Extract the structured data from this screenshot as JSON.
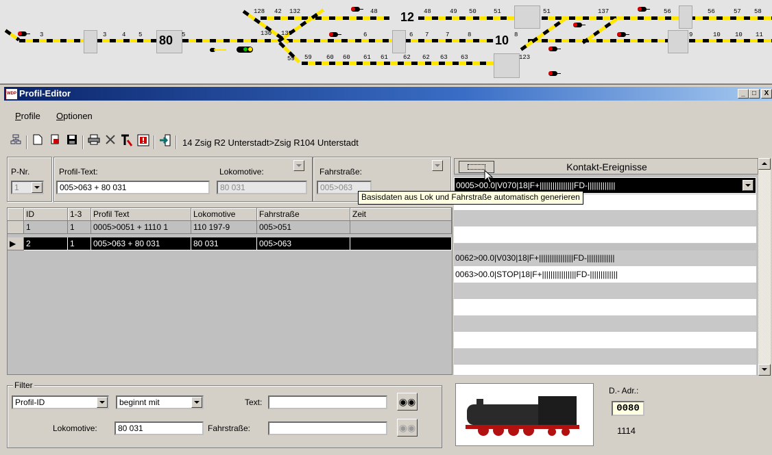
{
  "track_panel": {
    "big_numbers": [
      "80",
      "12",
      "10"
    ],
    "small_numbers": [
      "3",
      "3",
      "4",
      "5",
      "5",
      "128",
      "42",
      "132",
      "48",
      "48",
      "49",
      "50",
      "51",
      "51",
      "137",
      "56",
      "56",
      "57",
      "58",
      "6",
      "6",
      "7",
      "7",
      "8",
      "8",
      "9",
      "10",
      "10",
      "11",
      "59",
      "59",
      "60",
      "60",
      "61",
      "61",
      "62",
      "62",
      "63",
      "63",
      "123",
      "130",
      "135"
    ]
  },
  "window": {
    "title": "Profil-Editor",
    "app_icon_text": "WDP",
    "controls": [
      "_",
      "□",
      "X"
    ]
  },
  "menu": {
    "items": [
      {
        "label": "Profile",
        "underline": "P",
        "rest": "rofile"
      },
      {
        "label": "Optionen",
        "underline": "O",
        "rest": "ptionen"
      }
    ]
  },
  "toolbar": {
    "route_text": "14 Zsig R2 Unterstadt>Zsig R104 Unterstadt",
    "icons": [
      "tree-icon",
      "new-document-icon",
      "print-preview-icon",
      "save-icon",
      "printer-icon",
      "delete-icon",
      "text-tool-icon",
      "alert-icon",
      "exit-icon"
    ]
  },
  "fields": {
    "pnr_label": "P-Nr.",
    "pnr_value": "1",
    "profiltext_label": "Profil-Text:",
    "profiltext_value": "005>063 + 80 031",
    "lokomotive_label": "Lokomotive:",
    "lokomotive_value": "80 031",
    "fahrstrasse_label": "Fahrstraße:",
    "fahrstrasse_value": "005>063"
  },
  "table": {
    "headers": [
      "ID",
      "1-3",
      "Profil Text",
      "Lokomotive",
      "Fahrstraße",
      "Zeit"
    ],
    "rows": [
      {
        "id": "1",
        "n": "1",
        "text": "0005>0051 + 1110 1",
        "lok": "110 197-9",
        "fahr": "005>051",
        "zeit": ""
      },
      {
        "id": "2",
        "n": "1",
        "text": "005>063 + 80 031",
        "lok": "80 031",
        "fahr": "005>063",
        "zeit": ""
      }
    ]
  },
  "kontakt": {
    "header": "Kontakt-Ereignisse",
    "rows": [
      "0005>00.0|V070|18|F+||||||||||||||||FD-|||||||||||||",
      "",
      "",
      "",
      "0062>00.0|V030|18|F+||||||||||||||||FD-|||||||||||||",
      "0063>00.0|STOP|18|F+||||||||||||||||FD-|||||||||||||",
      "",
      "",
      "",
      "",
      "",
      ""
    ]
  },
  "tooltip": "Basisdaten aus Lok und Fahrstraße automatisch generieren",
  "filter": {
    "legend": "Filter",
    "field_select": "Profil-ID",
    "mode_select": "beginnt mit",
    "text_label": "Text:",
    "text_value": "",
    "lok_label": "Lokomotive:",
    "lok_value": "80 031",
    "fahr_label": "Fahrstraße:",
    "fahr_value": ""
  },
  "decoder": {
    "label": "D.- Adr.:",
    "address": "0080",
    "number": "1114"
  },
  "colors": {
    "title_start": "#0a246a",
    "title_end": "#a6caf0",
    "track_yellow": "#ffe600",
    "selection": "#000000",
    "tooltip_bg": "#ffffe1"
  }
}
